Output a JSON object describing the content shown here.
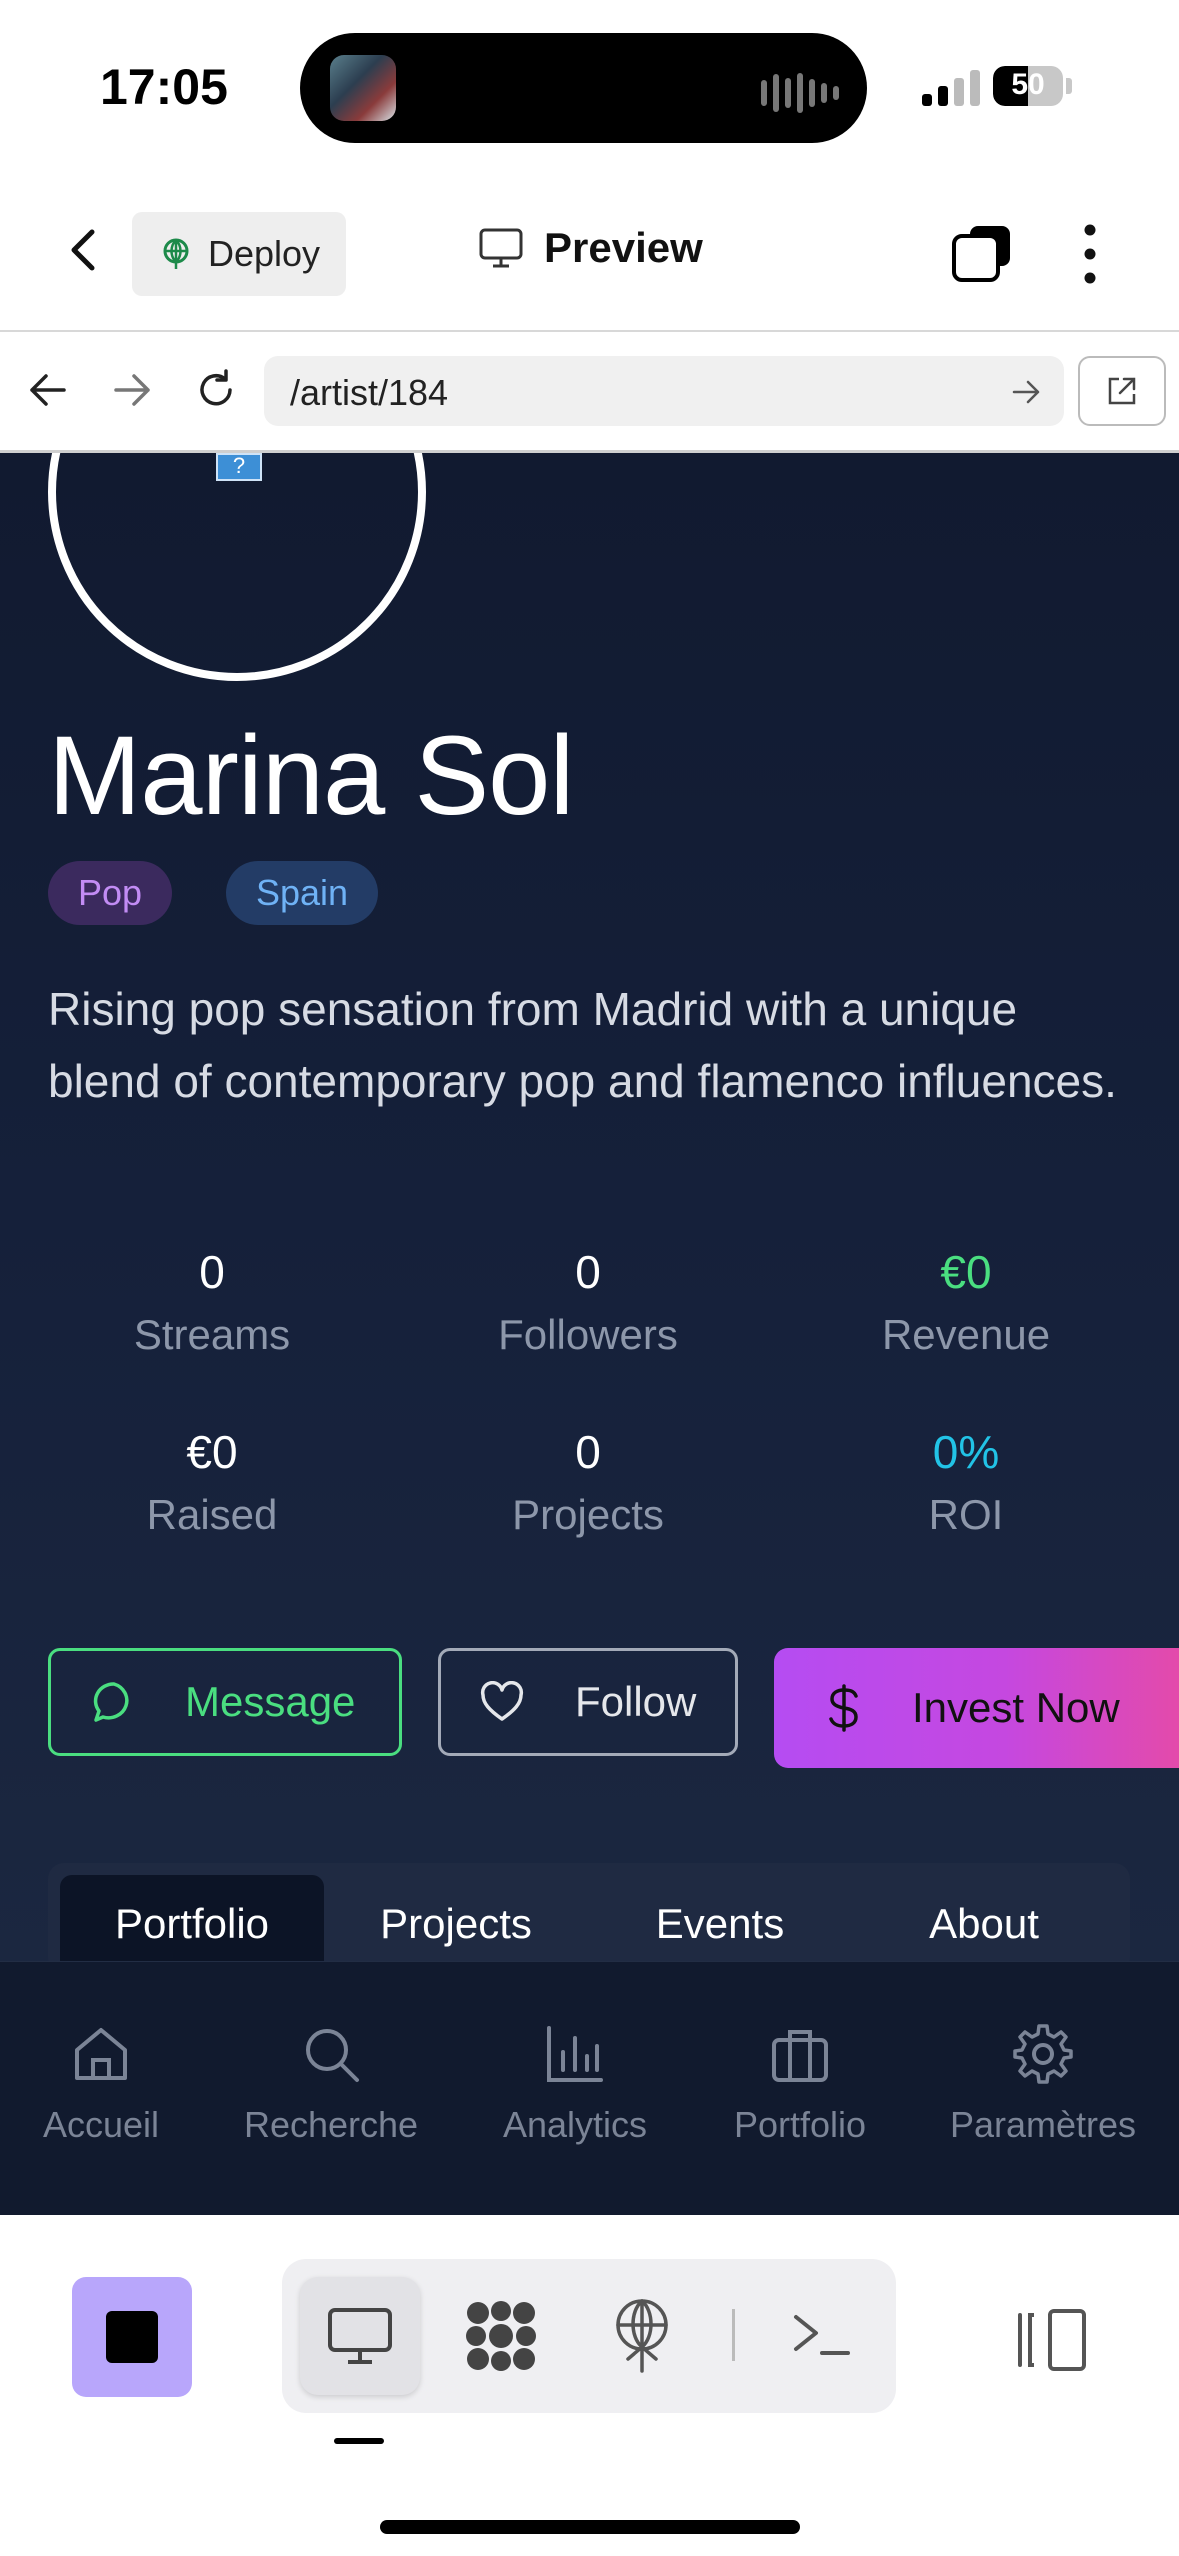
{
  "status_bar": {
    "time": "17:05",
    "battery": "50",
    "battery_level": 0.5
  },
  "header": {
    "deploy_label": "Deploy",
    "preview_label": "Preview"
  },
  "url_bar": {
    "url": "/artist/184"
  },
  "artist": {
    "name": "Marina Sol",
    "tags": [
      "Pop",
      "Spain"
    ],
    "bio": "Rising pop sensation from Madrid with a unique blend of contemporary pop and flamenco influences.",
    "stats": [
      {
        "value": "0",
        "label": "Streams"
      },
      {
        "value": "0",
        "label": "Followers"
      },
      {
        "value": "€0",
        "label": "Revenue",
        "color": "#4ade80"
      },
      {
        "value": "€0",
        "label": "Raised"
      },
      {
        "value": "0",
        "label": "Projects"
      },
      {
        "value": "0%",
        "label": "ROI",
        "color": "#22c3e6"
      }
    ]
  },
  "actions": {
    "message": "Message",
    "follow": "Follow",
    "invest": "Invest Now"
  },
  "tabs": [
    "Portfolio",
    "Projects",
    "Events",
    "About"
  ],
  "active_tab": "Portfolio",
  "bottom_nav": [
    "Accueil",
    "Recherche",
    "Analytics",
    "Portfolio",
    "Paramètres"
  ],
  "colors": {
    "accent_green": "#4ade80",
    "accent_cyan": "#22c3e6",
    "invest_gradient_start": "#b54cf2",
    "invest_gradient_end": "#e64aa6",
    "background": "#15203a"
  }
}
